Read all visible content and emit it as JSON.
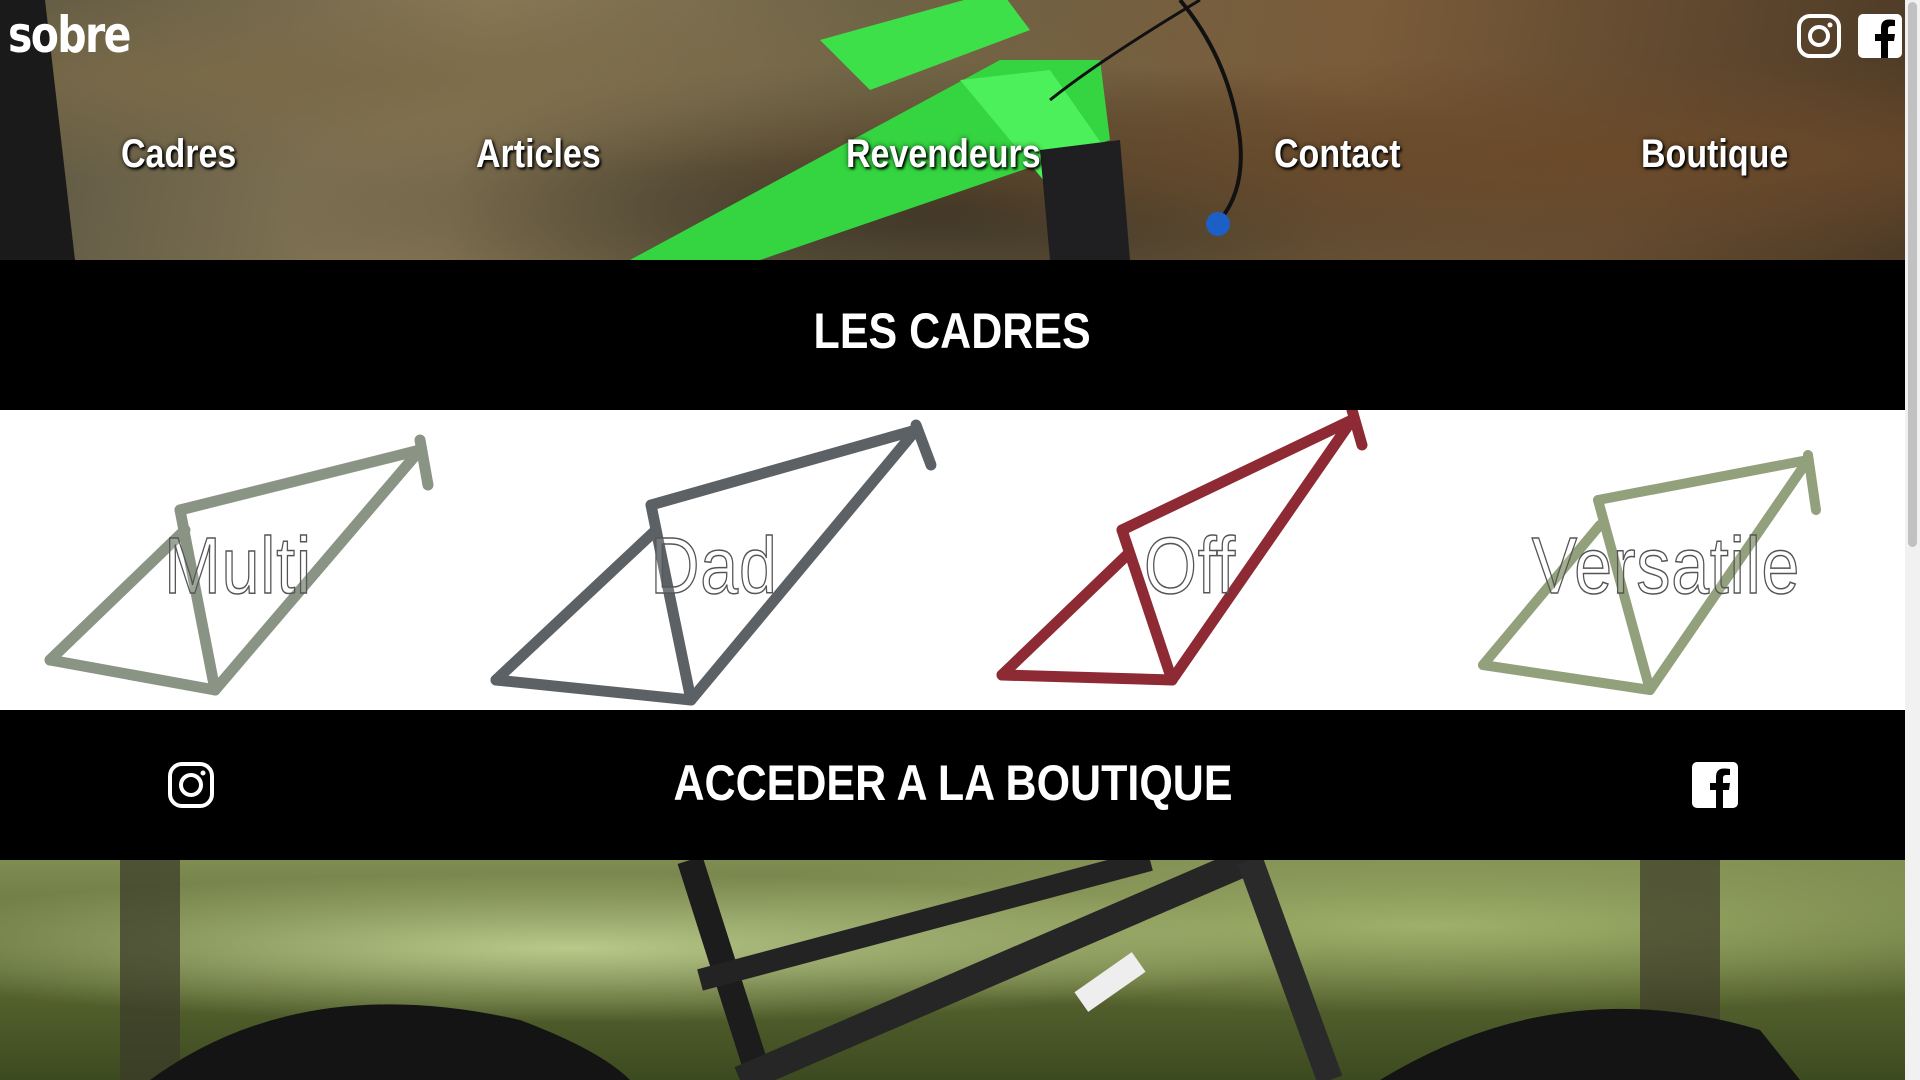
{
  "brand": {
    "logo_text": "sobre"
  },
  "nav": {
    "items": [
      {
        "label": "Cadres"
      },
      {
        "label": "Articles"
      },
      {
        "label": "Revendeurs"
      },
      {
        "label": "Contact"
      },
      {
        "label": "Boutique"
      }
    ]
  },
  "social": {
    "instagram_icon": "instagram-icon",
    "facebook_icon": "facebook-icon"
  },
  "frames_section": {
    "title": "LES CADRES",
    "frames": [
      {
        "label": "Multi",
        "color": "#8a9485"
      },
      {
        "label": "Dad",
        "color": "#5c6166"
      },
      {
        "label": "Off",
        "color": "#8e2a34"
      },
      {
        "label": "Versatile",
        "color": "#93a07c"
      }
    ]
  },
  "shop_band": {
    "label": "ACCEDER A LA BOUTIQUE"
  },
  "colors": {
    "accent_green": "#3ee04a",
    "band_bg": "#000000"
  }
}
